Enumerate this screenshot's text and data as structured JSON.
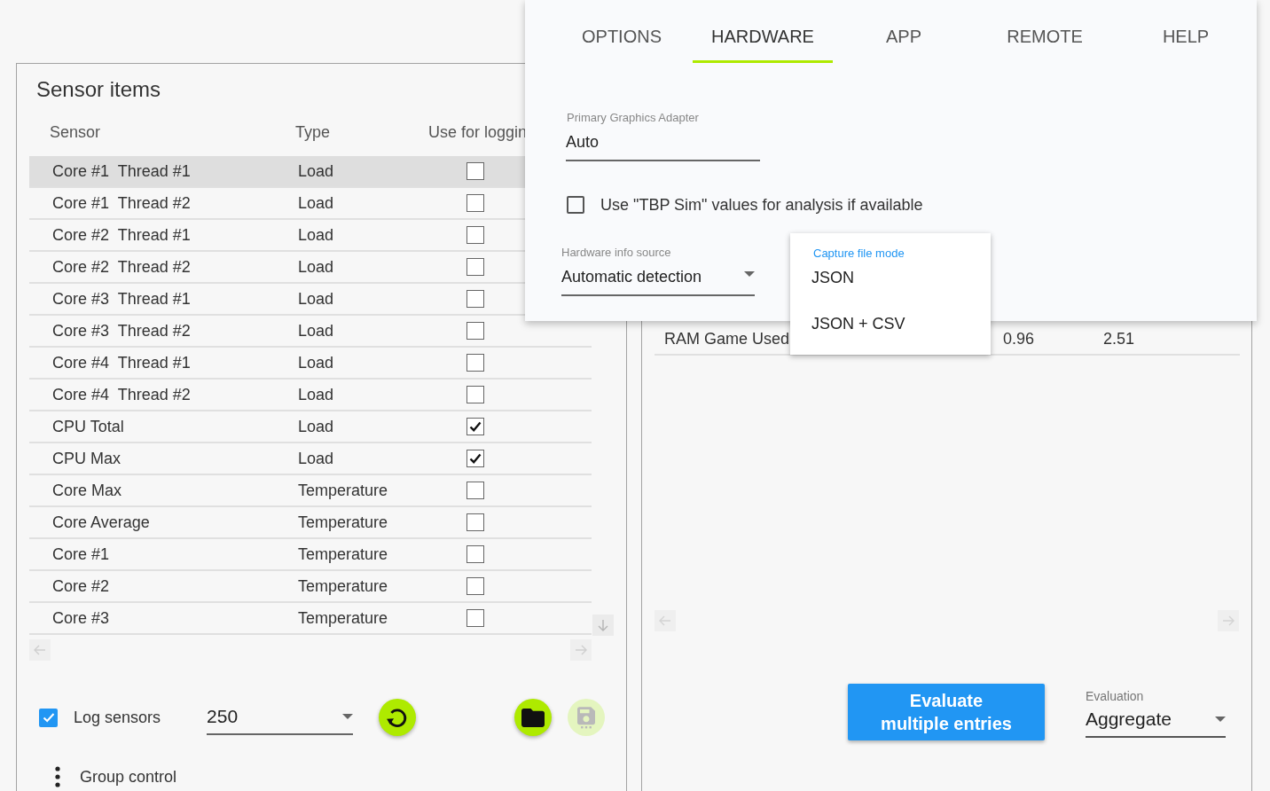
{
  "sensor_panel": {
    "title": "Sensor items",
    "columns": [
      "Sensor",
      "Type",
      "Use for loggin"
    ],
    "rows": [
      {
        "sensor": "Core #1  Thread #1",
        "type": "Load",
        "use_for_logging": false,
        "selected": true
      },
      {
        "sensor": "Core #1  Thread #2",
        "type": "Load",
        "use_for_logging": false,
        "selected": false
      },
      {
        "sensor": "Core #2  Thread #1",
        "type": "Load",
        "use_for_logging": false,
        "selected": false
      },
      {
        "sensor": "Core #2  Thread #2",
        "type": "Load",
        "use_for_logging": false,
        "selected": false
      },
      {
        "sensor": "Core #3  Thread #1",
        "type": "Load",
        "use_for_logging": false,
        "selected": false
      },
      {
        "sensor": "Core #3  Thread #2",
        "type": "Load",
        "use_for_logging": false,
        "selected": false
      },
      {
        "sensor": "Core #4  Thread #1",
        "type": "Load",
        "use_for_logging": false,
        "selected": false
      },
      {
        "sensor": "Core #4  Thread #2",
        "type": "Load",
        "use_for_logging": false,
        "selected": false
      },
      {
        "sensor": "CPU Total",
        "type": "Load",
        "use_for_logging": true,
        "selected": false
      },
      {
        "sensor": "CPU Max",
        "type": "Load",
        "use_for_logging": true,
        "selected": false
      },
      {
        "sensor": "Core Max",
        "type": "Temperature",
        "use_for_logging": false,
        "selected": false
      },
      {
        "sensor": "Core Average",
        "type": "Temperature",
        "use_for_logging": false,
        "selected": false
      },
      {
        "sensor": "Core #1",
        "type": "Temperature",
        "use_for_logging": false,
        "selected": false
      },
      {
        "sensor": "Core #2",
        "type": "Temperature",
        "use_for_logging": false,
        "selected": false
      },
      {
        "sensor": "Core #3",
        "type": "Temperature",
        "use_for_logging": false,
        "selected": false
      }
    ],
    "log_sensors": {
      "label": "Log sensors",
      "checked": true
    },
    "interval": {
      "value": "250"
    },
    "refresh_button": {
      "disabled": false
    },
    "file_buttons": [
      {
        "kind": "open",
        "disabled": false
      },
      {
        "kind": "save",
        "disabled": true
      }
    ],
    "group_control": {
      "label": "Group control"
    }
  },
  "results_panel": {
    "rows": [
      {
        "cells": [
          "RAM Game Used",
          "0.96",
          "2.51"
        ]
      }
    ],
    "evaluate_button": {
      "label": "Evaluate\nmultiple entries"
    },
    "evaluation": {
      "label": "Evaluation",
      "value": "Aggregate"
    }
  },
  "settings_dialog": {
    "tabs": [
      {
        "label": "OPTIONS",
        "selected": false
      },
      {
        "label": "HARDWARE",
        "selected": true
      },
      {
        "label": "APP",
        "selected": false
      },
      {
        "label": "REMOTE",
        "selected": false
      },
      {
        "label": "HELP",
        "selected": false
      }
    ],
    "primary_graphics_adapter": {
      "label": "Primary Graphics Adapter",
      "value": "Auto"
    },
    "tbp_sim": {
      "label": "Use \"TBP Sim\" values for analysis if available",
      "checked": false
    },
    "hardware_info_source": {
      "label": "Hardware info source",
      "value": "Automatic detection"
    },
    "capture_file_mode": {
      "label": "Capture file mode",
      "options": [
        {
          "label": "JSON",
          "selected": false
        },
        {
          "label": "JSON + CSV",
          "selected": false
        }
      ]
    }
  }
}
